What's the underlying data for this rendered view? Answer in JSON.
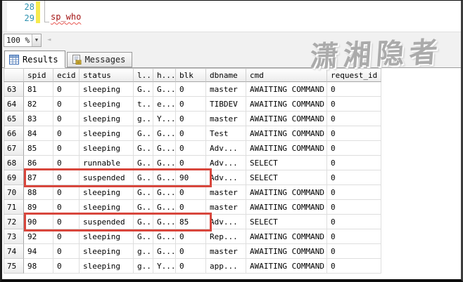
{
  "editor": {
    "line_numbers": [
      "28",
      "29"
    ],
    "code_line": "sp_who"
  },
  "status_strip": {
    "zoom_value": "100 %",
    "zoom_dropdown_glyph": "▼",
    "scroll_left_glyph": "◄"
  },
  "tabs": {
    "results": "Results",
    "messages": "Messages"
  },
  "watermark_text": "潇湘隐者",
  "grid": {
    "columns": [
      "",
      "spid",
      "ecid",
      "status",
      "l...",
      "h...",
      "blk",
      "dbname",
      "cmd",
      "request_id"
    ],
    "rows": [
      [
        "63",
        "81",
        "0",
        "sleeping",
        "G...",
        "G...",
        "0",
        "master",
        "AWAITING COMMAND",
        "0"
      ],
      [
        "64",
        "82",
        "0",
        "sleeping",
        "t...",
        "e...",
        "0",
        "TIBDEV",
        "AWAITING COMMAND",
        "0"
      ],
      [
        "65",
        "83",
        "0",
        "sleeping",
        "g...",
        "Y...",
        "0",
        "master",
        "AWAITING COMMAND",
        "0"
      ],
      [
        "66",
        "84",
        "0",
        "sleeping",
        "G...",
        "G...",
        "0",
        "Test",
        "AWAITING COMMAND",
        "0"
      ],
      [
        "67",
        "85",
        "0",
        "sleeping",
        "G...",
        "G...",
        "0",
        "Adv...",
        "AWAITING COMMAND",
        "0"
      ],
      [
        "68",
        "86",
        "0",
        "runnable",
        "G...",
        "G...",
        "0",
        "Adv...",
        "SELECT",
        "0"
      ],
      [
        "69",
        "87",
        "0",
        "suspended",
        "G...",
        "G...",
        "90",
        "Adv...",
        "SELECT",
        "0"
      ],
      [
        "70",
        "88",
        "0",
        "sleeping",
        "G...",
        "G...",
        "0",
        "master",
        "AWAITING COMMAND",
        "0"
      ],
      [
        "71",
        "89",
        "0",
        "sleeping",
        "G...",
        "G...",
        "0",
        "master",
        "AWAITING COMMAND",
        "0"
      ],
      [
        "72",
        "90",
        "0",
        "suspended",
        "G...",
        "G...",
        "85",
        "Adv...",
        "SELECT",
        "0"
      ],
      [
        "73",
        "92",
        "0",
        "sleeping",
        "G...",
        "G...",
        "0",
        "Rep...",
        "AWAITING COMMAND",
        "0"
      ],
      [
        "74",
        "94",
        "0",
        "sleeping",
        "g...",
        "G...",
        "0",
        "master",
        "AWAITING COMMAND",
        "0"
      ],
      [
        "75",
        "98",
        "0",
        "sleeping",
        "g...",
        "Y...",
        "0",
        "app...",
        "AWAITING COMMAND",
        "0"
      ]
    ],
    "highlighted_row_numbers": [
      "69",
      "72"
    ]
  },
  "colors": {
    "highlight_red": "#d8463c",
    "line_number_teal": "#2B91AF",
    "proc_name_maroon": "#a31515",
    "changebar_yellow": "#f6ea4e"
  }
}
